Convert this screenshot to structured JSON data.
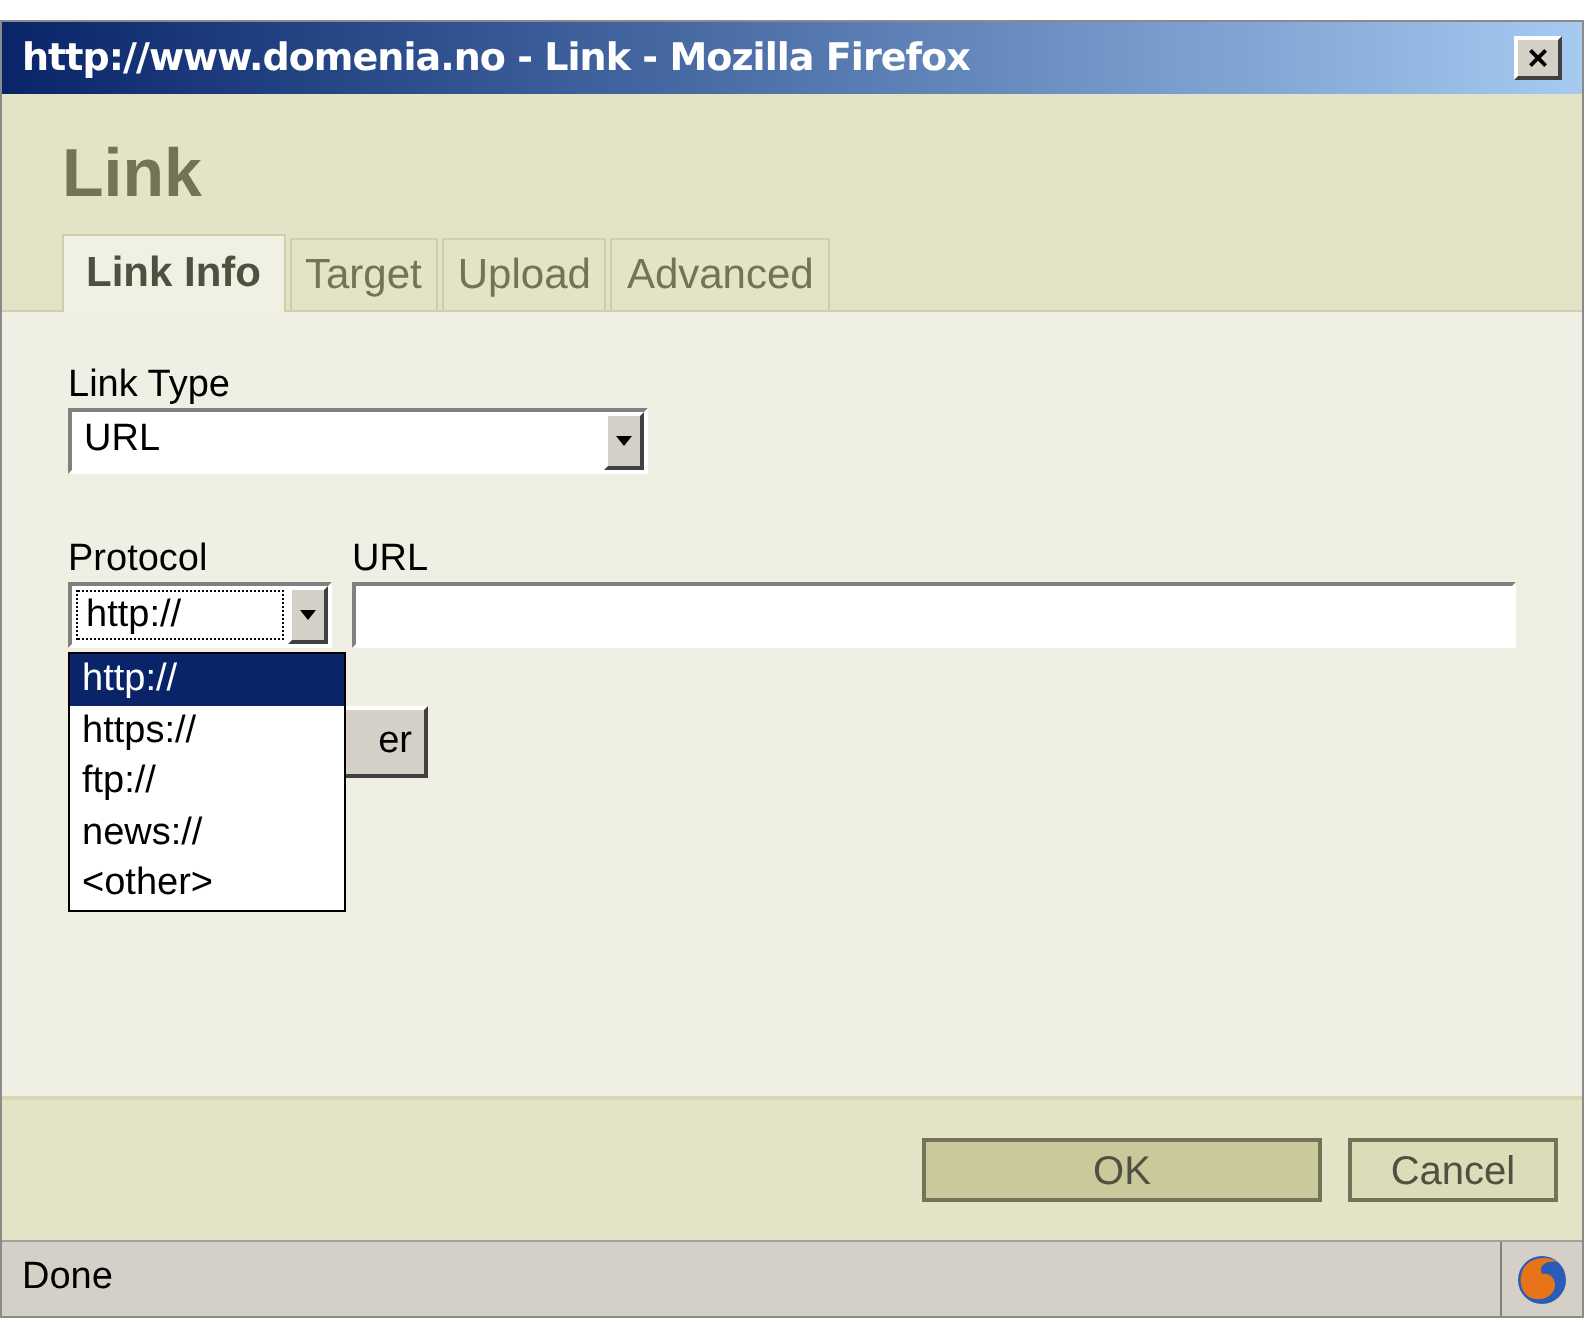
{
  "window": {
    "title": "http://www.domenia.no - Link - Mozilla Firefox",
    "close": "×"
  },
  "heading": "Link",
  "tabs": [
    {
      "label": "Link Info",
      "selected": true
    },
    {
      "label": "Target",
      "selected": false
    },
    {
      "label": "Upload",
      "selected": false
    },
    {
      "label": "Advanced",
      "selected": false
    }
  ],
  "link_type": {
    "label": "Link Type",
    "value": "URL"
  },
  "protocol": {
    "label": "Protocol",
    "value": "http://",
    "expanded": true,
    "options": [
      {
        "label": "http://",
        "selected": true
      },
      {
        "label": "https://",
        "selected": false
      },
      {
        "label": "ftp://",
        "selected": false
      },
      {
        "label": "news://",
        "selected": false
      },
      {
        "label": "<other>",
        "selected": false
      }
    ]
  },
  "url": {
    "label": "URL"
  },
  "covered_button": "er",
  "buttons": [
    {
      "label": "OK",
      "kind": "primary"
    },
    {
      "label": "Cancel",
      "kind": "secondary"
    }
  ],
  "status_bar": "Done"
}
